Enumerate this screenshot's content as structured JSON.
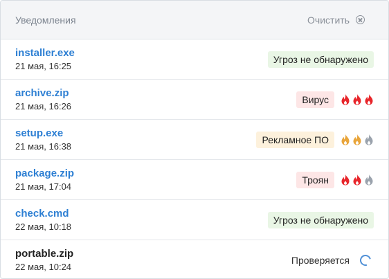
{
  "header": {
    "title": "Уведомления",
    "clear_label": "Очистить"
  },
  "colors": {
    "danger": "#e8262b",
    "warning": "#e9a53a",
    "inactive": "#9ba3ad",
    "link": "#2d7fd3"
  },
  "rows": [
    {
      "name": "installer.exe",
      "date": "21 мая, 16:25",
      "status": "Угроз не обнаружено",
      "kind": "clean",
      "flames": []
    },
    {
      "name": "archive.zip",
      "date": "21 мая, 16:26",
      "status": "Вирус",
      "kind": "danger",
      "flames": [
        "danger",
        "danger",
        "danger"
      ]
    },
    {
      "name": "setup.exe",
      "date": "21 мая, 16:38",
      "status": "Рекламное ПО",
      "kind": "warn",
      "flames": [
        "warning",
        "warning",
        "inactive"
      ]
    },
    {
      "name": "package.zip",
      "date": "21 мая, 17:04",
      "status": "Троян",
      "kind": "danger",
      "flames": [
        "danger",
        "danger",
        "inactive"
      ]
    },
    {
      "name": "check.cmd",
      "date": "22 мая, 10:18",
      "status": "Угроз не обнаружено",
      "kind": "clean",
      "flames": []
    },
    {
      "name": "portable.zip",
      "date": "22 мая, 10:24",
      "status": "Проверяется",
      "kind": "pending",
      "flames": []
    }
  ]
}
